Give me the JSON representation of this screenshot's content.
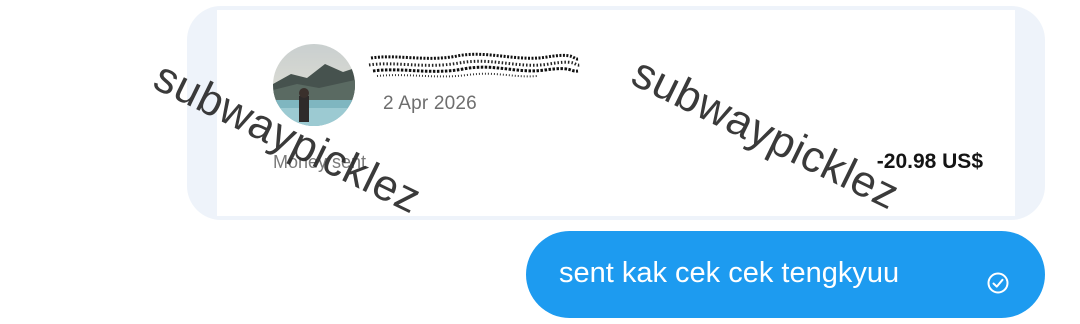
{
  "transaction_card": {
    "date": "2 Apr 2026",
    "label": "Money sent",
    "amount": "-20.98 US$",
    "avatar_icon": "profile-photo-avatar",
    "name_icon": "redacted-name-scribble"
  },
  "watermarks": [
    "subwaypicklez",
    "subwaypicklez"
  ],
  "message": {
    "text": "sent kak cek cek tengkyuu",
    "status_icon": "read-receipt-check-icon",
    "bubble_color": "#1d9bf0"
  },
  "colors": {
    "card_bubble": "#eef3fa",
    "card_inner": "#ffffff"
  }
}
